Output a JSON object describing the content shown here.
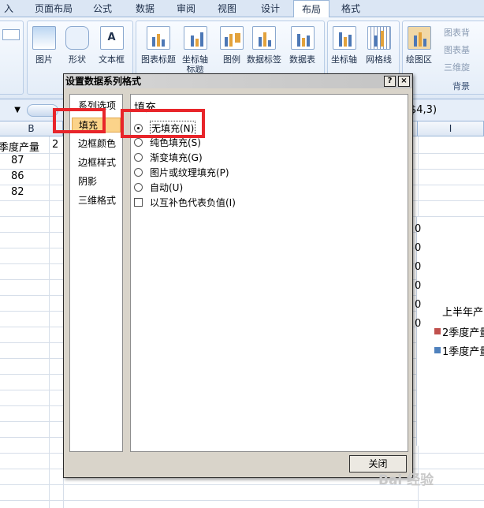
{
  "ribbon_tabs": [
    "入",
    "页面布局",
    "公式",
    "数据",
    "审阅",
    "视图",
    "设计",
    "布局",
    "格式"
  ],
  "ribbon": {
    "group1_buttons": [
      "图片",
      "形状",
      "文本框"
    ],
    "group2_buttons": [
      "图表标题",
      "坐标轴",
      "图例",
      "数据标签",
      "数据表"
    ],
    "axis_title_cut": "标题",
    "group3_buttons": [
      "坐标轴",
      "网格线"
    ],
    "plot_area": "绘图区",
    "right_buttons": [
      "图表背",
      "图表基",
      "三维旋"
    ],
    "background_group_label": "背景"
  },
  "formula": {
    "name_box_arrow": "▼",
    "formula_text": "$4,3)"
  },
  "sheet": {
    "col_headers": {
      "B": "B",
      "I": "I"
    },
    "cells": {
      "b1": "季度产量",
      "c1_partial": "2",
      "b2": "87",
      "b3": "86",
      "b4": "82"
    }
  },
  "chart": {
    "axis_zeros": [
      "0",
      "0",
      "0",
      "0",
      "0",
      "0"
    ],
    "legend_title": "上半年产",
    "legend_items": [
      {
        "label": "2季度产量",
        "color": "#c0504d"
      },
      {
        "label": "1季度产量",
        "color": "#4f81bd"
      }
    ]
  },
  "dialog": {
    "title": "设置数据系列格式",
    "help_button": "?",
    "close_x": "×",
    "nav_items": [
      "系列选项",
      "填充",
      "边框颜色",
      "边框样式",
      "阴影",
      "三维格式"
    ],
    "section_title": "填充",
    "fill_options": [
      {
        "label": "无填充(N)",
        "selected": true
      },
      {
        "label": "纯色填充(S)",
        "selected": false
      },
      {
        "label": "渐变填充(G)",
        "selected": false
      },
      {
        "label": "图片或纹理填充(P)",
        "selected": false
      },
      {
        "label": "自动(U)",
        "selected": false
      }
    ],
    "invert_checkbox": "以互补色代表负值(I)",
    "close_button": "关闭"
  },
  "colors": {
    "highlight": "#e8252a",
    "ribbon_bg": "#dfe9f6",
    "dialog_bg": "#d9d4ca"
  },
  "watermark": "Bai 经验"
}
